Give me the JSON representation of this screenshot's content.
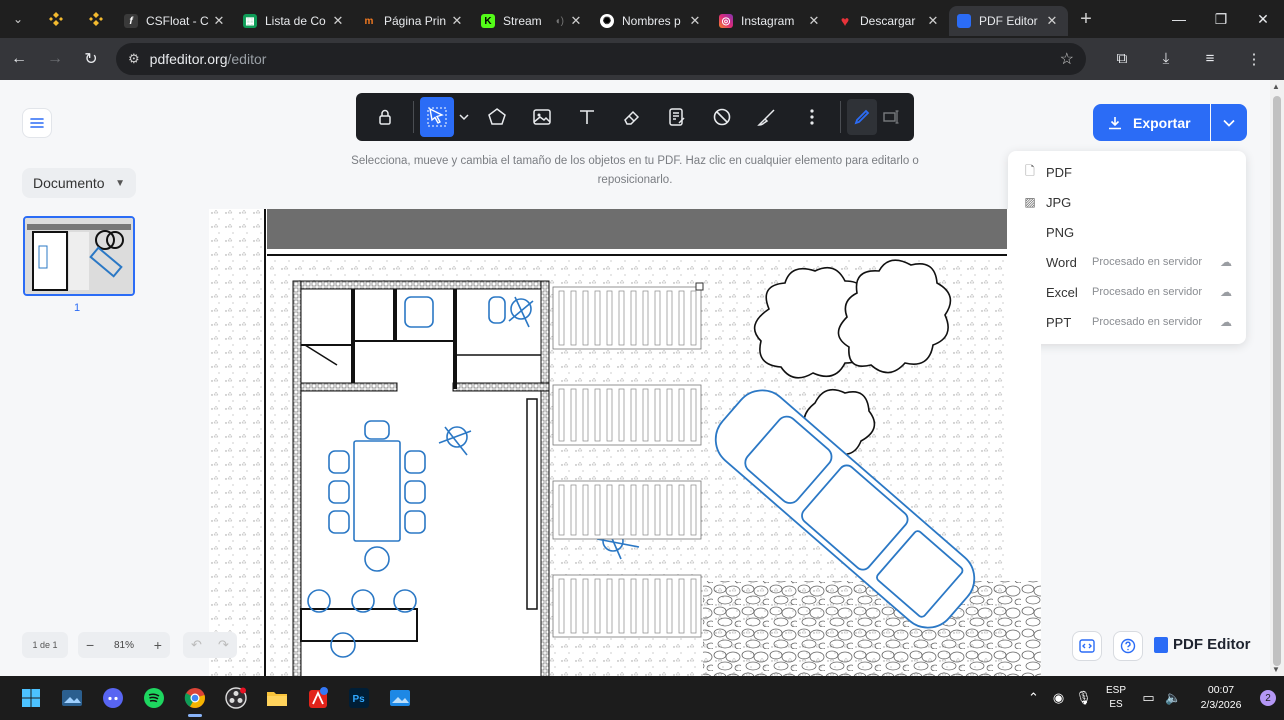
{
  "browser": {
    "tabs": [
      {
        "label": "CSFloat - C",
        "favicon": "f",
        "color": "#3a3a3a",
        "active": false
      },
      {
        "label": "Lista de Co",
        "favicon": "sheets-icon",
        "color": "#0f9d58",
        "active": false
      },
      {
        "label": "Página Prin",
        "favicon": "m",
        "color": "#1f1f1f",
        "active": false
      },
      {
        "label": "Stream",
        "favicon": "K",
        "color": "#53fc18",
        "active": false
      },
      {
        "label": "Nombres p",
        "favicon": "openai-icon",
        "color": "#ffffff",
        "active": false
      },
      {
        "label": "Instagram",
        "favicon": "instagram-icon",
        "color": "#e1306c",
        "active": false
      },
      {
        "label": "Descargar",
        "favicon": "heart-icon",
        "color": "#e8333a",
        "active": false
      },
      {
        "label": "PDF Editor",
        "favicon": "pdf-editor-icon",
        "color": "#2b6cf6",
        "active": true
      }
    ],
    "url_site": "pdfeditor.org",
    "url_path": "/editor"
  },
  "app": {
    "sidebar": {
      "document_select": "Documento",
      "page_number": "1"
    },
    "toolbar_hint": "Selecciona, mueve y cambia el tamaño de los objetos en tu PDF. Haz clic en cualquier elemento para editarlo o reposicionarlo.",
    "export": {
      "button_label": "Exportar",
      "menu": [
        {
          "label": "PDF",
          "icon": "file-icon",
          "note": "",
          "cloud": false
        },
        {
          "label": "JPG",
          "icon": "image-icon",
          "note": "",
          "cloud": false
        },
        {
          "label": "PNG",
          "icon": "image-icon",
          "note": "",
          "cloud": false
        },
        {
          "label": "Word",
          "icon": "file-text-icon",
          "note": "Procesado en servidor",
          "cloud": true
        },
        {
          "label": "Excel",
          "icon": "grid-icon",
          "note": "Procesado en servidor",
          "cloud": true
        },
        {
          "label": "PPT",
          "icon": "presentation-icon",
          "note": "Procesado en servidor",
          "cloud": true
        }
      ]
    },
    "footer": {
      "pager": "1 de 1",
      "zoom": "81%",
      "brand": "PDF Editor"
    }
  },
  "taskbar": {
    "lang_top": "ESP",
    "lang_bottom": "ES",
    "time": "00:07",
    "date": "2/3/2026",
    "notifications": "2"
  },
  "colors": {
    "accent": "#2b6cf6",
    "drawing_blue": "#2b78c5"
  }
}
